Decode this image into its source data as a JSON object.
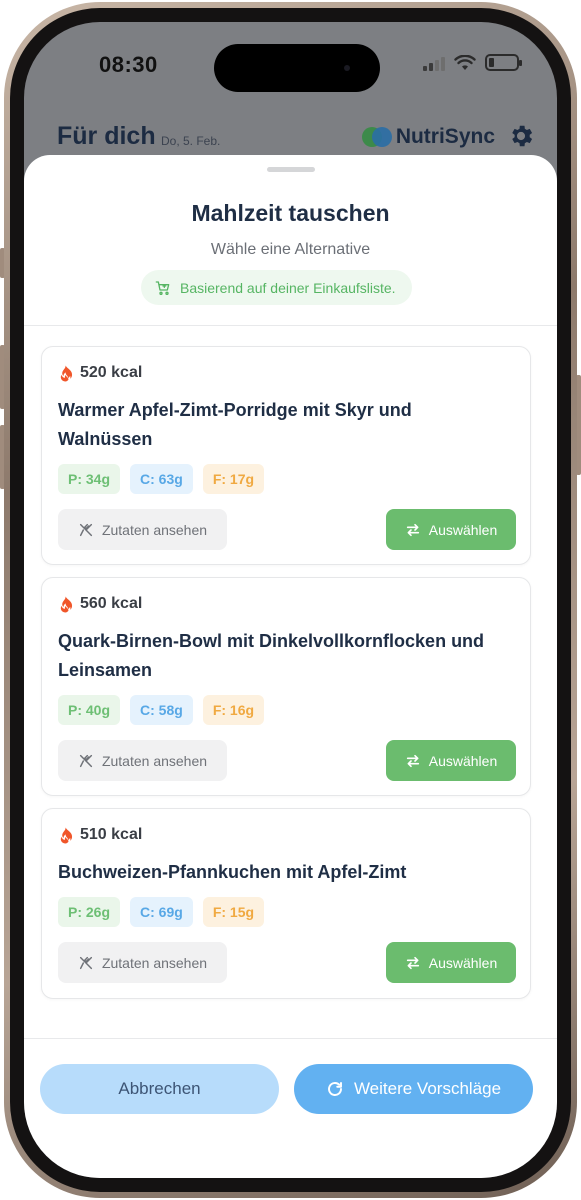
{
  "status_bar": {
    "time": "08:30"
  },
  "background_header": {
    "title": "Für dich",
    "date": "Do, 5. Feb.",
    "brand": "NutriSync"
  },
  "sheet": {
    "title": "Mahlzeit tauschen",
    "subtitle": "Wähle eine Alternative",
    "info_pill": "Basierend auf deiner Einkaufsliste."
  },
  "meals": [
    {
      "kcal": "520 kcal",
      "title": "Warmer Apfel-Zimt-Porridge mit Skyr und Walnüssen",
      "protein": "P: 34g",
      "carbs": "C: 63g",
      "fat": "F: 17g",
      "ingredients_label": "Zutaten ansehen",
      "select_label": "Auswählen"
    },
    {
      "kcal": "560 kcal",
      "title": "Quark-Birnen-Bowl mit Dinkelvollkornflocken und Leinsamen",
      "protein": "P: 40g",
      "carbs": "C: 58g",
      "fat": "F: 16g",
      "ingredients_label": "Zutaten ansehen",
      "select_label": "Auswählen"
    },
    {
      "kcal": "510 kcal",
      "title": "Buchweizen-Pfannkuchen mit Apfel-Zimt",
      "protein": "P: 26g",
      "carbs": "C: 69g",
      "fat": "F: 15g",
      "ingredients_label": "Zutaten ansehen",
      "select_label": "Auswählen"
    }
  ],
  "footer": {
    "cancel_label": "Abbrechen",
    "more_label": "Weitere Vorschläge"
  },
  "icons": {
    "kcal": "flame-icon",
    "info": "shopping-cart-icon",
    "ingredients": "utensils-icon",
    "select": "swap-arrows-icon",
    "more": "refresh-icon",
    "settings": "gear-icon"
  },
  "colors": {
    "primary_text": "#1f2e45",
    "accent_green": "#6bbc6e",
    "accent_blue": "#62b1f1",
    "cancel_bg": "#b7dcfb",
    "flame": "#f0562a",
    "protein": "#6dbf74",
    "carbs": "#58a8e6",
    "fat": "#f0a941"
  }
}
